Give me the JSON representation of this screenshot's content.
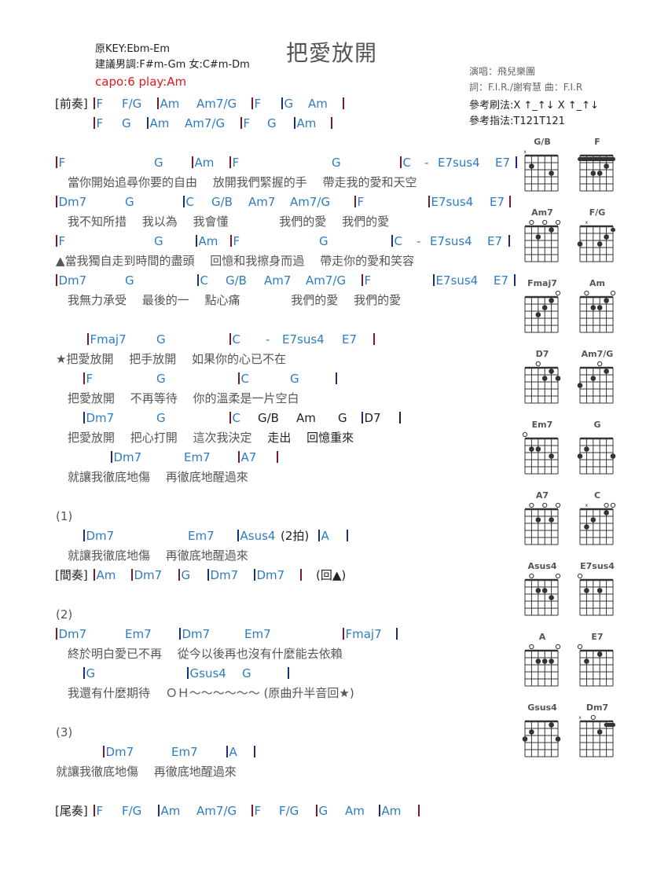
{
  "header": {
    "original_key": "原KEY:Ebm-Em",
    "suggested_key": "建議男調:F#m-Gm 女:C#m-Dm",
    "capo": "capo:6 play:Am",
    "title": "把愛放開",
    "singer": "演唱：飛兒樂團",
    "credits": "詞：F.I.R./謝宥慧   曲：F.I.R",
    "strum": "參考刷法:X ↑_↑↓ X ↑_↑↓",
    "finger": "參考指法:T121T121"
  },
  "lines": [
    {
      "label": "[前奏]",
      "chords": [
        "F",
        "F/G",
        "Am",
        "Am7/G",
        "F",
        "G",
        "Am",
        ""
      ]
    },
    {
      "chords": [
        "F",
        "G",
        "Am",
        "Am7/G",
        "F",
        "G",
        "Am",
        ""
      ]
    },
    {
      "chords": [
        "F",
        "G",
        "Am",
        "F",
        "G",
        "C",
        "-",
        "E7sus4",
        "E7",
        ""
      ]
    },
    {
      "lyric": "當你開始追尋你要的自由　 放開我們緊握的手　 帶走我的愛和天空"
    },
    {
      "chords": [
        "Dm7",
        "G",
        "C",
        "G/B",
        "Am7",
        "Am7/G",
        "F",
        "E7sus4",
        "E7",
        ""
      ]
    },
    {
      "lyric": "我不知所措　 我以為　 我會懂　　　　 我們的愛　 我們的愛"
    },
    {
      "chords": [
        "F",
        "G",
        "Am",
        "F",
        "G",
        "C",
        "-",
        "E7sus4",
        "E7",
        ""
      ]
    },
    {
      "lyric": "▲當我獨自走到時間的盡頭　 回憶和我擦身而過　 帶走你的愛和笑容"
    },
    {
      "chords": [
        "Dm7",
        "G",
        "C",
        "G/B",
        "Am7",
        "Am7/G",
        "F",
        "E7sus4",
        "E7",
        ""
      ]
    },
    {
      "lyric": "我無力承受　 最後的一　 點心痛　　　　 我們的愛　 我們的愛"
    },
    {
      "chords": [
        "Fmaj7",
        "G",
        "C",
        "-",
        "E7sus4",
        "E7",
        ""
      ]
    },
    {
      "lyric": "★把愛放開　 把手放開　 如果你的心已不在"
    },
    {
      "chords": [
        "F",
        "G",
        "C",
        "G",
        ""
      ]
    },
    {
      "lyric": "把愛放開　 不再等待　 你的溫柔是一片空白"
    },
    {
      "chords": [
        "Dm7",
        "G",
        "C",
        "G/B",
        "Am",
        "G",
        "D7",
        ""
      ]
    },
    {
      "lyric": "把愛放開　 把心打開　 這次我決定　 走出　 回憶重來"
    },
    {
      "chords": [
        "Dm7",
        "Em7",
        "A7",
        ""
      ]
    },
    {
      "lyric": "就讓我徹底地傷　 再徹底地醒過來"
    },
    {
      "section": "(1)"
    },
    {
      "chords": [
        "Dm7",
        "Em7",
        "Asus4",
        "(2拍)",
        "A",
        ""
      ]
    },
    {
      "lyric": "就讓我徹底地傷　 再徹底地醒過來"
    },
    {
      "label": "[間奏]",
      "chords": [
        "Am",
        "Dm7",
        "G",
        "Dm7",
        "Dm7",
        "",
        "(回▲)"
      ]
    },
    {
      "section": "(2)"
    },
    {
      "chords": [
        "Dm7",
        "Em7",
        "Dm7",
        "Em7",
        "Fmaj7",
        ""
      ]
    },
    {
      "lyric": "終於明白愛已不再　 從今以後再也沒有什麼能去依賴"
    },
    {
      "chords": [
        "G",
        "Gsus4",
        "G",
        ""
      ]
    },
    {
      "lyric": "我還有什麼期待　 ＯＨ～～～～～～ (原曲升半音回★)"
    },
    {
      "section": "(3)"
    },
    {
      "chords": [
        "Dm7",
        "Em7",
        "A",
        ""
      ]
    },
    {
      "lyric": "就讓我徹底地傷　 再徹底地醒過來"
    },
    {
      "label": "[尾奏]",
      "chords": [
        "F",
        "F/G",
        "Am",
        "Am7/G",
        "F",
        "F/G",
        "G",
        "Am",
        "Am",
        ""
      ]
    }
  ],
  "chord_diagrams": [
    {
      "name": "G/B",
      "top": [
        "x",
        "",
        "",
        "",
        "",
        ""
      ],
      "dots": [
        [
          2,
          2
        ],
        [
          5,
          3
        ]
      ],
      "barre": null
    },
    {
      "name": "F",
      "top": [
        "",
        "",
        "",
        "",
        "",
        ""
      ],
      "dots": [
        [
          3,
          3
        ],
        [
          4,
          3
        ],
        [
          5,
          2
        ]
      ],
      "barre": [
        1,
        1,
        6
      ]
    },
    {
      "name": "Am7",
      "top": [
        "",
        "o",
        "",
        "o",
        "",
        "o"
      ],
      "dots": [
        [
          3,
          2
        ],
        [
          5,
          1
        ]
      ],
      "barre": null
    },
    {
      "name": "F/G",
      "top": [
        "",
        "x",
        "",
        "",
        "",
        ""
      ],
      "dots": [
        [
          1,
          3
        ],
        [
          4,
          3
        ],
        [
          5,
          2
        ]
      ],
      "barre": [
        1,
        6,
        6
      ]
    },
    {
      "name": "Fmaj7",
      "top": [
        "",
        "",
        "",
        "",
        "",
        "o"
      ],
      "dots": [
        [
          3,
          3
        ],
        [
          4,
          2
        ],
        [
          5,
          1
        ]
      ],
      "barre": null
    },
    {
      "name": "Am",
      "top": [
        "",
        "o",
        "",
        "",
        "",
        "o"
      ],
      "dots": [
        [
          3,
          2
        ],
        [
          4,
          2
        ],
        [
          5,
          1
        ]
      ],
      "barre": null
    },
    {
      "name": "D7",
      "top": [
        "",
        "",
        "o",
        "",
        "",
        ""
      ],
      "dots": [
        [
          4,
          2
        ],
        [
          5,
          1
        ],
        [
          6,
          2
        ]
      ],
      "barre": null
    },
    {
      "name": "Am7/G",
      "top": [
        "",
        "",
        "",
        "o",
        "",
        ""
      ],
      "dots": [
        [
          1,
          3
        ],
        [
          3,
          2
        ],
        [
          5,
          1
        ]
      ],
      "barre": null
    },
    {
      "name": "Em7",
      "top": [
        "o",
        "",
        "",
        "",
        "",
        ""
      ],
      "dots": [
        [
          2,
          2
        ],
        [
          3,
          2
        ],
        [
          5,
          3
        ]
      ],
      "barre": null
    },
    {
      "name": "G",
      "top": [
        "",
        "",
        "",
        "",
        "",
        ""
      ],
      "dots": [
        [
          1,
          3
        ],
        [
          2,
          2
        ],
        [
          6,
          3
        ]
      ],
      "barre": null
    },
    {
      "name": "A7",
      "top": [
        "",
        "o",
        "",
        "o",
        "",
        "o"
      ],
      "dots": [
        [
          3,
          2
        ],
        [
          5,
          2
        ]
      ],
      "barre": null
    },
    {
      "name": "C",
      "top": [
        "",
        "x",
        "",
        "",
        "o",
        "o"
      ],
      "dots": [
        [
          2,
          3
        ],
        [
          3,
          2
        ],
        [
          5,
          1
        ]
      ],
      "barre": null
    },
    {
      "name": "Asus4",
      "top": [
        "",
        "o",
        "",
        "",
        "",
        "o"
      ],
      "dots": [
        [
          3,
          2
        ],
        [
          4,
          2
        ],
        [
          5,
          3
        ]
      ],
      "barre": null
    },
    {
      "name": "E7sus4",
      "top": [
        "o",
        "",
        "",
        "",
        "",
        ""
      ],
      "dots": [
        [
          2,
          2
        ],
        [
          4,
          2
        ]
      ],
      "barre": null
    },
    {
      "name": "A",
      "top": [
        "",
        "o",
        "",
        "",
        "",
        "o"
      ],
      "dots": [
        [
          3,
          2
        ],
        [
          4,
          2
        ],
        [
          5,
          2
        ]
      ],
      "barre": null
    },
    {
      "name": "E7",
      "top": [
        "o",
        "",
        "",
        "",
        "",
        ""
      ],
      "dots": [
        [
          2,
          2
        ],
        [
          4,
          1
        ]
      ],
      "barre": null
    },
    {
      "name": "Gsus4",
      "top": [
        "",
        "",
        "",
        "",
        "",
        ""
      ],
      "dots": [
        [
          1,
          3
        ],
        [
          2,
          2
        ],
        [
          5,
          1
        ],
        [
          6,
          3
        ]
      ],
      "barre": null
    },
    {
      "name": "Dm7",
      "top": [
        "x",
        "",
        "o",
        "",
        "",
        ""
      ],
      "dots": [
        [
          4,
          2
        ]
      ],
      "barre": [
        1,
        5,
        6
      ]
    }
  ]
}
